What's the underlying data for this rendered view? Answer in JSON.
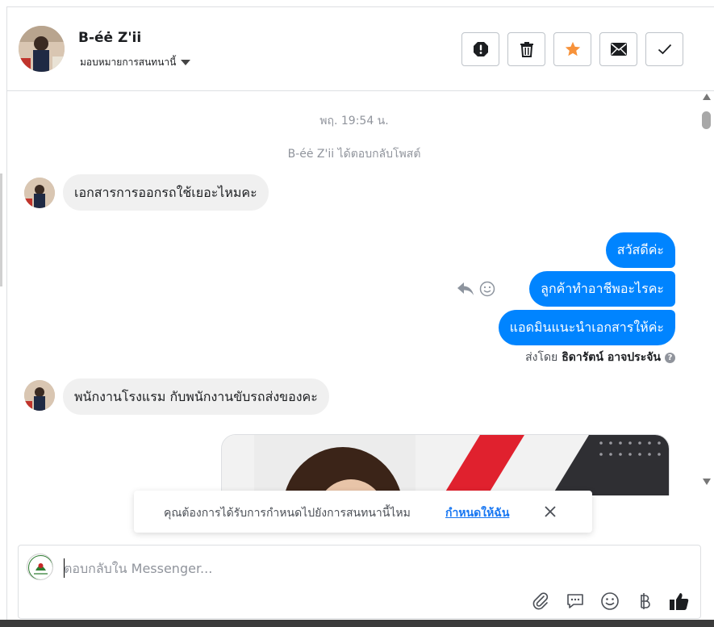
{
  "header": {
    "contact_name": "B-éė Z'ii",
    "assign_label": "มอบหมายการสนทนานี้",
    "toolbar": [
      {
        "name": "spam-button",
        "icon": "exclamation-icon"
      },
      {
        "name": "delete-button",
        "icon": "trash-icon"
      },
      {
        "name": "star-button",
        "icon": "star-icon",
        "color": "#f7923a"
      },
      {
        "name": "mark-unread-button",
        "icon": "envelope-icon"
      },
      {
        "name": "mark-done-button",
        "icon": "check-icon"
      }
    ]
  },
  "chat": {
    "timestamp": "พฤ. 19:54 น.",
    "system_note": "B-éė Z'ii ได้ตอบกลับโพสต์",
    "incoming_1": "เอกสารการออกรถใช้เยอะไหมคะ",
    "outgoing": [
      "สวัสดีค่ะ",
      "ลูกค้าทำอาชีพอะไรคะ",
      "แอดมินแนะนำเอกสารให้ค่ะ"
    ],
    "sent_by_label": "ส่งโดย",
    "sent_by_name": "ธิดารัตน์ อาจประจัน",
    "incoming_2": "พนักงานโรงแรม กับพนักงานขับรถส่งของคะ"
  },
  "toast": {
    "text": "คุณต้องการได้รับการกำหนดไปยังการสนทนานี้ไหม",
    "link": "กำหนดให้ฉัน"
  },
  "composer": {
    "placeholder": "ตอบกลับใน Messenger..."
  },
  "colors": {
    "accent": "#0084ff",
    "link": "#1877f2",
    "star": "#f7923a"
  }
}
